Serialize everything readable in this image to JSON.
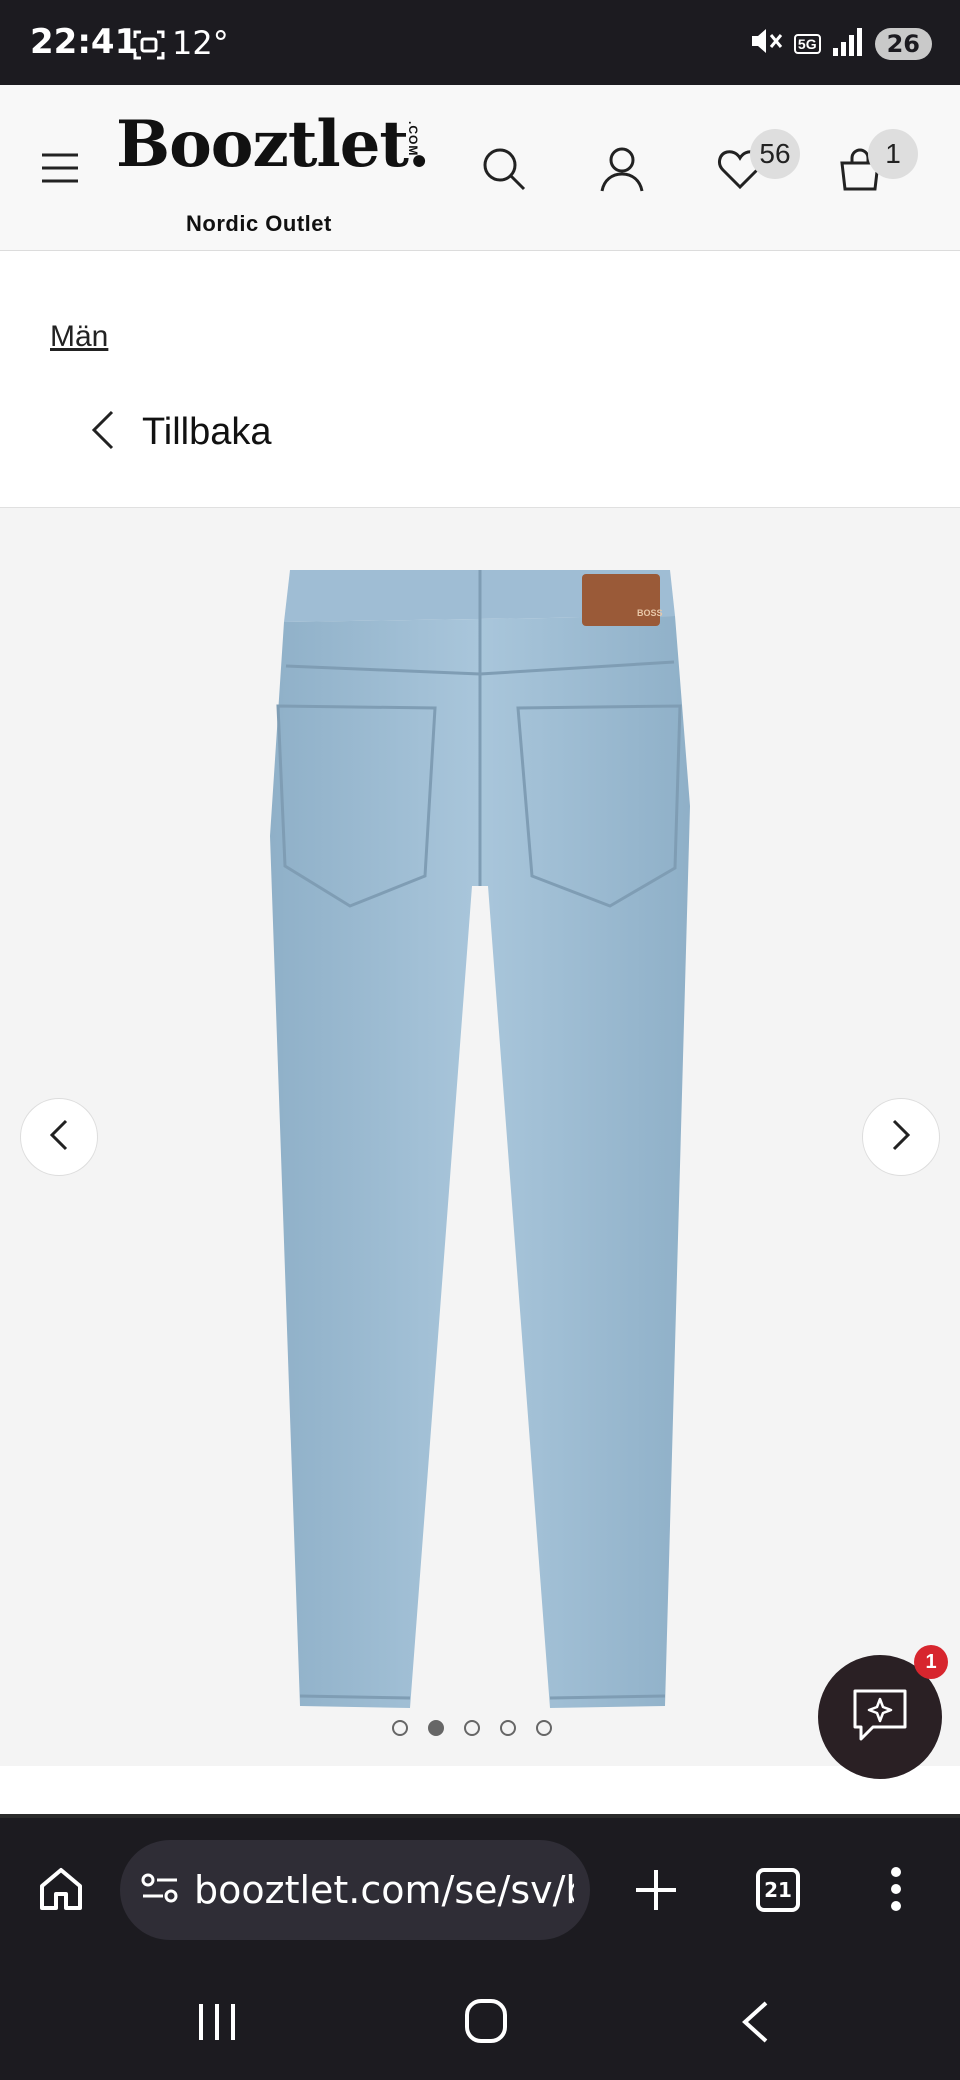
{
  "status_bar": {
    "time": "22:41",
    "temperature": "12°",
    "network_badge": "5G",
    "battery": "26"
  },
  "header": {
    "logo_text": "Booztlet",
    "logo_com": ".COM",
    "logo_tagline": "Nordic Outlet",
    "wishlist_count": "56",
    "cart_count": "1"
  },
  "breadcrumb": {
    "label": "Män"
  },
  "back": {
    "label": "Tillbaka"
  },
  "gallery": {
    "slide_count": 5,
    "active_slide": 2,
    "product_tag": "BOSS"
  },
  "chat": {
    "badge": "1"
  },
  "browser": {
    "url": "booztlet.com/se/sv/b",
    "tabs_count": "21"
  },
  "colors": {
    "header_bg": "#f8f8f8",
    "gallery_bg": "#f4f4f4",
    "chrome_bg": "#1c1b20",
    "chat_bg": "#2a2024",
    "badge_red": "#d7262e",
    "denim": "#9fbdd4"
  }
}
